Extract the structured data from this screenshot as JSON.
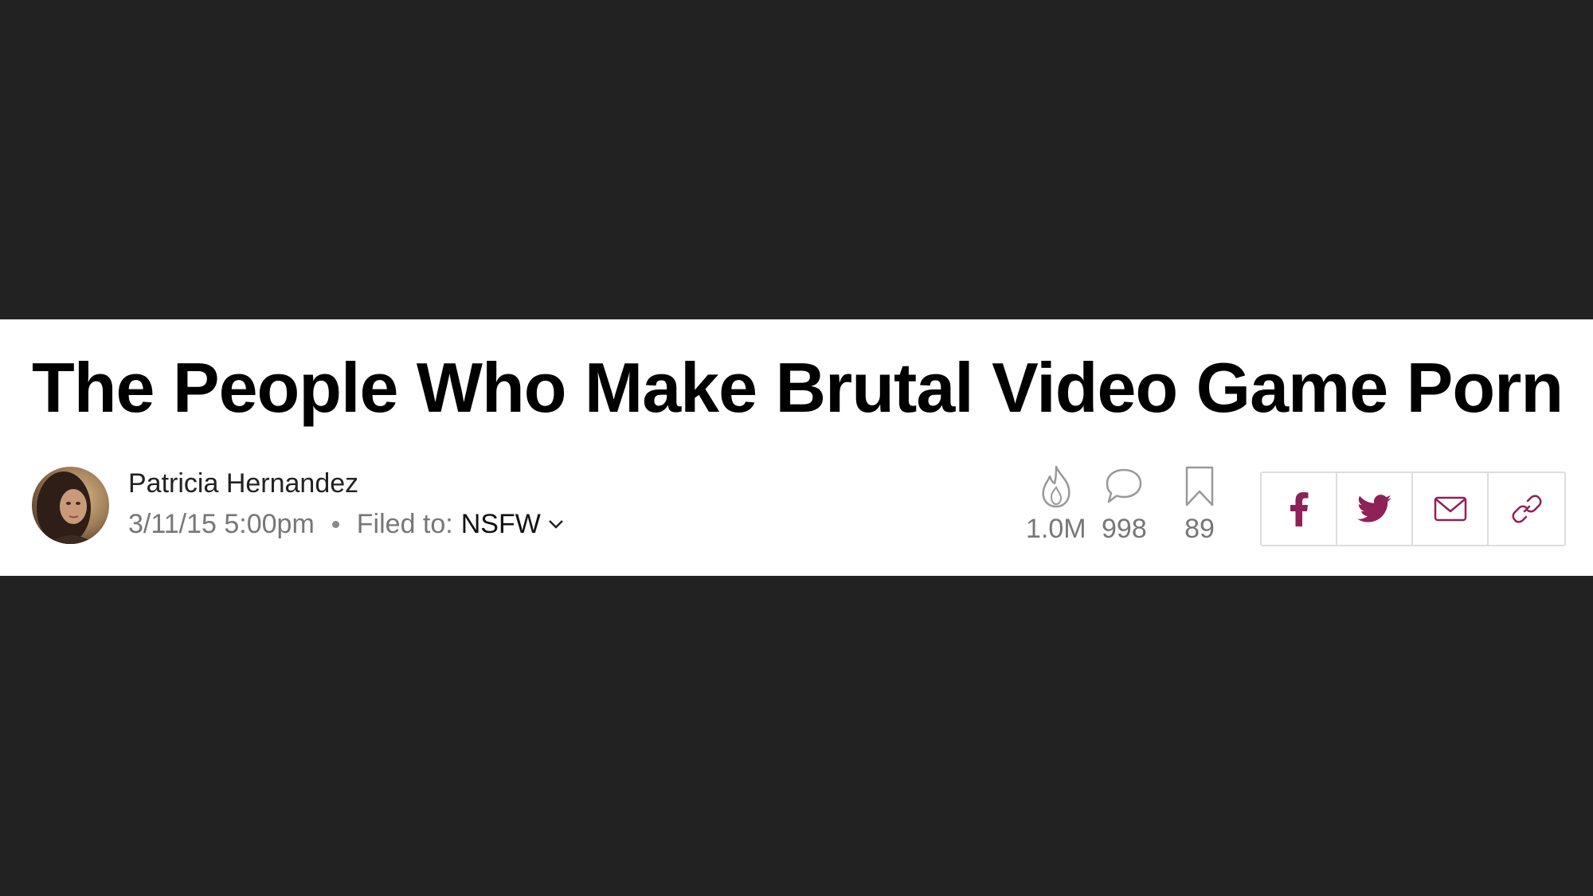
{
  "article": {
    "headline": "The People Who Make Brutal Video Game Porn",
    "author": "Patricia Hernandez",
    "timestamp": "3/11/15 5:00pm",
    "filed_label": "Filed to:",
    "category": "NSFW"
  },
  "stats": {
    "views": "1.0M",
    "comments": "998",
    "saves": "89"
  },
  "share": {
    "icons": [
      "facebook-icon",
      "twitter-icon",
      "email-icon",
      "link-icon"
    ],
    "accent_color": "#8e2157"
  },
  "theme": {
    "background": "#222222",
    "strip": "#ffffff",
    "stat_color": "#777777"
  }
}
